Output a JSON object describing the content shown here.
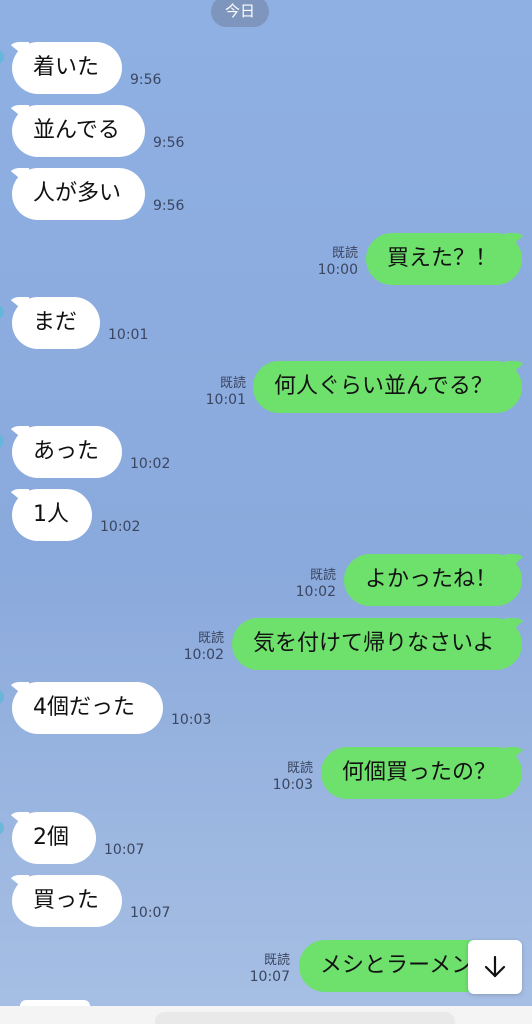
{
  "date_label": "今日",
  "read_label": "既読",
  "messages": [
    {
      "dir": "in",
      "text": "着いた",
      "time": "9:56"
    },
    {
      "dir": "in",
      "text": "並んでる",
      "time": "9:56"
    },
    {
      "dir": "in",
      "text": "人が多い",
      "time": "9:56"
    },
    {
      "dir": "out",
      "text": "買えた？！",
      "time": "10:00"
    },
    {
      "dir": "in",
      "text": "まだ",
      "time": "10:01"
    },
    {
      "dir": "out",
      "text": "何人ぐらい並んでる？",
      "time": "10:01"
    },
    {
      "dir": "in",
      "text": "あった",
      "time": "10:02"
    },
    {
      "dir": "in",
      "text": "1人",
      "time": "10:02"
    },
    {
      "dir": "out",
      "text": "よかったね！",
      "time": "10:02"
    },
    {
      "dir": "out",
      "text": "気を付けて帰りなさいよ",
      "time": "10:02"
    },
    {
      "dir": "in",
      "text": "4個だった",
      "time": "10:03"
    },
    {
      "dir": "out",
      "text": "何個買ったの？",
      "time": "10:03"
    },
    {
      "dir": "in",
      "text": "2個",
      "time": "10:07"
    },
    {
      "dir": "in",
      "text": "買った",
      "time": "10:07"
    },
    {
      "dir": "out",
      "text": "メシとラーメン",
      "time": "10:07"
    }
  ],
  "scroll_button": {
    "icon": "arrow-down-icon"
  }
}
